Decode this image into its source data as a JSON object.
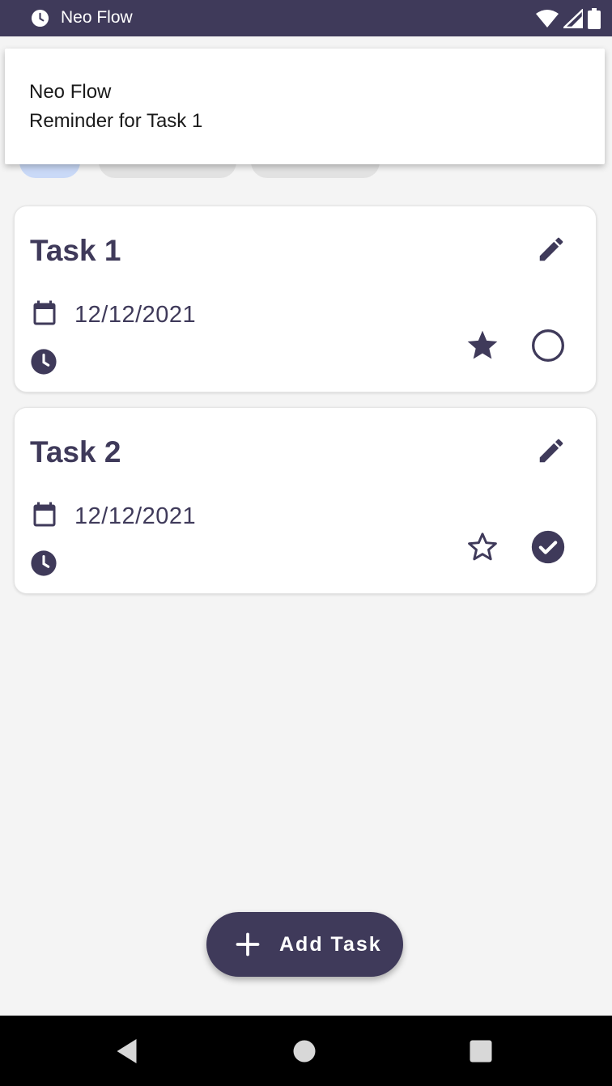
{
  "status_bar": {
    "app_name": "Neo Flow",
    "icons": [
      "clock-icon",
      "wifi-icon",
      "signal-icon",
      "battery-icon"
    ]
  },
  "notification": {
    "title": "Neo Flow",
    "text": "Reminder for Task 1"
  },
  "tasks": [
    {
      "title": "Task 1",
      "date": "12/12/2021",
      "starred": true,
      "completed": false
    },
    {
      "title": "Task 2",
      "date": "12/12/2021",
      "starred": false,
      "completed": true
    }
  ],
  "fab": {
    "label": "Add Task",
    "icon": "plus-icon"
  },
  "nav_bar": {
    "icons": [
      "back-icon",
      "home-icon",
      "recents-icon"
    ]
  },
  "colors": {
    "primary": "#3f3a5a",
    "background": "#f4f4f4",
    "card": "#ffffff",
    "chip_selected": "#c9d9f7"
  }
}
